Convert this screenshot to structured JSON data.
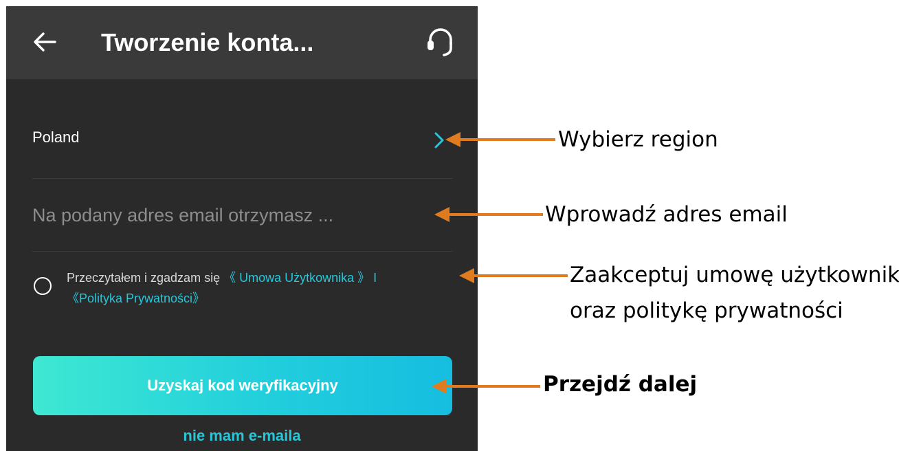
{
  "header": {
    "title": "Tworzenie konta...",
    "back_icon": "arrow-left-icon",
    "support_icon": "headset-icon"
  },
  "form": {
    "region_value": "Poland",
    "region_icon": "chevron-right-icon",
    "email_placeholder": "Na podany adres email otrzymasz ...",
    "agreement": {
      "text": "Przeczytałem i zgadzam się",
      "user_agreement_link": "《 Umowa Użytkownika 》",
      "separator": "I",
      "privacy_policy_link": "《Polityka Prywatności》"
    },
    "submit_label": "Uzyskaj kod weryfikacyjny",
    "no_email_link": "nie mam e-maila"
  },
  "annotations": {
    "region": "Wybierz region",
    "email": "Wprowadź adres email",
    "agreement_line1": "Zaakceptuj umowę użytkownika",
    "agreement_line2": "oraz politykę prywatności",
    "next": "Przejdź dalej"
  },
  "colors": {
    "background": "#2a2a2a",
    "header": "#3a3a3a",
    "accent": "#27c6d9",
    "button_gradient_start": "#3ee8d2",
    "button_gradient_end": "#16bde0",
    "annotation_arrow": "#e07b1f"
  }
}
